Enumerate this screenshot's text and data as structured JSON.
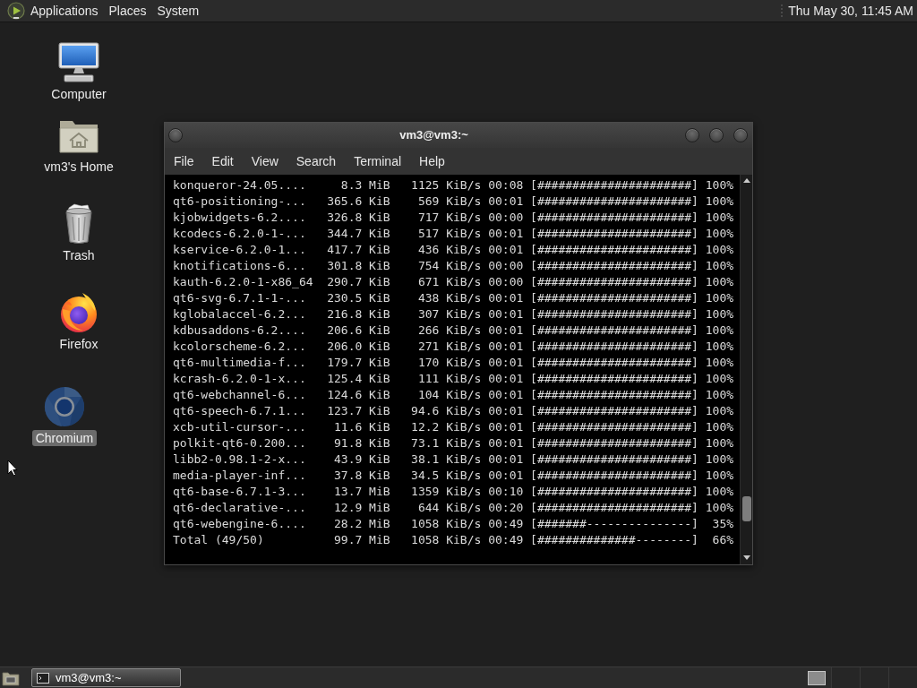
{
  "top_panel": {
    "menus": [
      "Applications",
      "Places",
      "System"
    ],
    "clock": "Thu May 30, 11:45 AM"
  },
  "desktop_icons": [
    {
      "label": "Computer",
      "kind": "computer",
      "selected": false
    },
    {
      "label": "vm3's Home",
      "kind": "home",
      "selected": false
    },
    {
      "label": "Trash",
      "kind": "trash",
      "selected": false
    },
    {
      "label": "Firefox",
      "kind": "firefox",
      "selected": false
    },
    {
      "label": "Chromium",
      "kind": "chromium",
      "selected": true
    }
  ],
  "window": {
    "title": "vm3@vm3:~",
    "menu": [
      "File",
      "Edit",
      "View",
      "Search",
      "Terminal",
      "Help"
    ],
    "rows": [
      {
        "name": "konqueror-24.05....",
        "size": "8.3 MiB",
        "rate": "1125 KiB/s",
        "time": "00:08",
        "bar": "[######################]",
        "percent": "100%"
      },
      {
        "name": "qt6-positioning-...",
        "size": "365.6 KiB",
        "rate": "569 KiB/s",
        "time": "00:01",
        "bar": "[######################]",
        "percent": "100%"
      },
      {
        "name": "kjobwidgets-6.2....",
        "size": "326.8 KiB",
        "rate": "717 KiB/s",
        "time": "00:00",
        "bar": "[######################]",
        "percent": "100%"
      },
      {
        "name": "kcodecs-6.2.0-1-...",
        "size": "344.7 KiB",
        "rate": "517 KiB/s",
        "time": "00:01",
        "bar": "[######################]",
        "percent": "100%"
      },
      {
        "name": "kservice-6.2.0-1...",
        "size": "417.7 KiB",
        "rate": "436 KiB/s",
        "time": "00:01",
        "bar": "[######################]",
        "percent": "100%"
      },
      {
        "name": "knotifications-6...",
        "size": "301.8 KiB",
        "rate": "754 KiB/s",
        "time": "00:00",
        "bar": "[######################]",
        "percent": "100%"
      },
      {
        "name": "kauth-6.2.0-1-x86_64",
        "size": "290.7 KiB",
        "rate": "671 KiB/s",
        "time": "00:00",
        "bar": "[######################]",
        "percent": "100%"
      },
      {
        "name": "qt6-svg-6.7.1-1-...",
        "size": "230.5 KiB",
        "rate": "438 KiB/s",
        "time": "00:01",
        "bar": "[######################]",
        "percent": "100%"
      },
      {
        "name": "kglobalaccel-6.2...",
        "size": "216.8 KiB",
        "rate": "307 KiB/s",
        "time": "00:01",
        "bar": "[######################]",
        "percent": "100%"
      },
      {
        "name": "kdbusaddons-6.2....",
        "size": "206.6 KiB",
        "rate": "266 KiB/s",
        "time": "00:01",
        "bar": "[######################]",
        "percent": "100%"
      },
      {
        "name": "kcolorscheme-6.2...",
        "size": "206.0 KiB",
        "rate": "271 KiB/s",
        "time": "00:01",
        "bar": "[######################]",
        "percent": "100%"
      },
      {
        "name": "qt6-multimedia-f...",
        "size": "179.7 KiB",
        "rate": "170 KiB/s",
        "time": "00:01",
        "bar": "[######################]",
        "percent": "100%"
      },
      {
        "name": "kcrash-6.2.0-1-x...",
        "size": "125.4 KiB",
        "rate": "111 KiB/s",
        "time": "00:01",
        "bar": "[######################]",
        "percent": "100%"
      },
      {
        "name": "qt6-webchannel-6...",
        "size": "124.6 KiB",
        "rate": "104 KiB/s",
        "time": "00:01",
        "bar": "[######################]",
        "percent": "100%"
      },
      {
        "name": "qt6-speech-6.7.1...",
        "size": "123.7 KiB",
        "rate": "94.6 KiB/s",
        "time": "00:01",
        "bar": "[######################]",
        "percent": "100%"
      },
      {
        "name": "xcb-util-cursor-...",
        "size": "11.6 KiB",
        "rate": "12.2 KiB/s",
        "time": "00:01",
        "bar": "[######################]",
        "percent": "100%"
      },
      {
        "name": "polkit-qt6-0.200...",
        "size": "91.8 KiB",
        "rate": "73.1 KiB/s",
        "time": "00:01",
        "bar": "[######################]",
        "percent": "100%"
      },
      {
        "name": "libb2-0.98.1-2-x...",
        "size": "43.9 KiB",
        "rate": "38.1 KiB/s",
        "time": "00:01",
        "bar": "[######################]",
        "percent": "100%"
      },
      {
        "name": "media-player-inf...",
        "size": "37.8 KiB",
        "rate": "34.5 KiB/s",
        "time": "00:01",
        "bar": "[######################]",
        "percent": "100%"
      },
      {
        "name": "qt6-base-6.7.1-3...",
        "size": "13.7 MiB",
        "rate": "1359 KiB/s",
        "time": "00:10",
        "bar": "[######################]",
        "percent": "100%"
      },
      {
        "name": "qt6-declarative-...",
        "size": "12.9 MiB",
        "rate": "644 KiB/s",
        "time": "00:20",
        "bar": "[######################]",
        "percent": "100%"
      },
      {
        "name": "qt6-webengine-6....",
        "size": "28.2 MiB",
        "rate": "1058 KiB/s",
        "time": "00:49",
        "bar": "[#######---------------]",
        "percent": "35%"
      },
      {
        "name": "Total (49/50)",
        "size": "99.7 MiB",
        "rate": "1058 KiB/s",
        "time": "00:49",
        "bar": "[##############--------]",
        "percent": "66%"
      }
    ]
  },
  "taskbar": {
    "tasks": [
      {
        "label": "vm3@vm3:~",
        "selected": true
      }
    ],
    "workspaces": [
      {
        "selected": true
      },
      {
        "selected": false
      },
      {
        "selected": false
      },
      {
        "selected": false
      }
    ]
  }
}
